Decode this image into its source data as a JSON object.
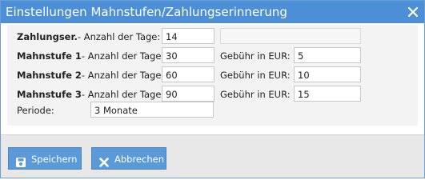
{
  "window": {
    "title": "Einstellungen Mahnstufen/Zahlungserinnerung"
  },
  "rows": [
    {
      "bold_label": "Zahlungser.",
      "label": "- Anzahl der Tage:",
      "days": "14",
      "fee_label": "",
      "fee": ""
    },
    {
      "bold_label": "Mahnstufe 1",
      "label": "- Anzahl der Tage:",
      "days": "30",
      "fee_label": "Gebühr in EUR:",
      "fee": "5"
    },
    {
      "bold_label": "Mahnstufe 2",
      "label": "- Anzahl der Tage:",
      "days": "60",
      "fee_label": "Gebühr in EUR:",
      "fee": "10"
    },
    {
      "bold_label": "Mahnstufe 3",
      "label": "- Anzahl der Tage:",
      "days": "90",
      "fee_label": "Gebühr in EUR:",
      "fee": "15"
    }
  ],
  "period": {
    "label": "Periode:",
    "value": "3 Monate"
  },
  "buttons": {
    "save": "Speichern",
    "cancel": "Abbrechen"
  },
  "colors": {
    "titlebar": "#4d8fd6",
    "button": "#5b9ad8"
  },
  "icons": {
    "close": "close-icon",
    "save": "floppy-disk-icon",
    "cancel": "x-icon"
  }
}
